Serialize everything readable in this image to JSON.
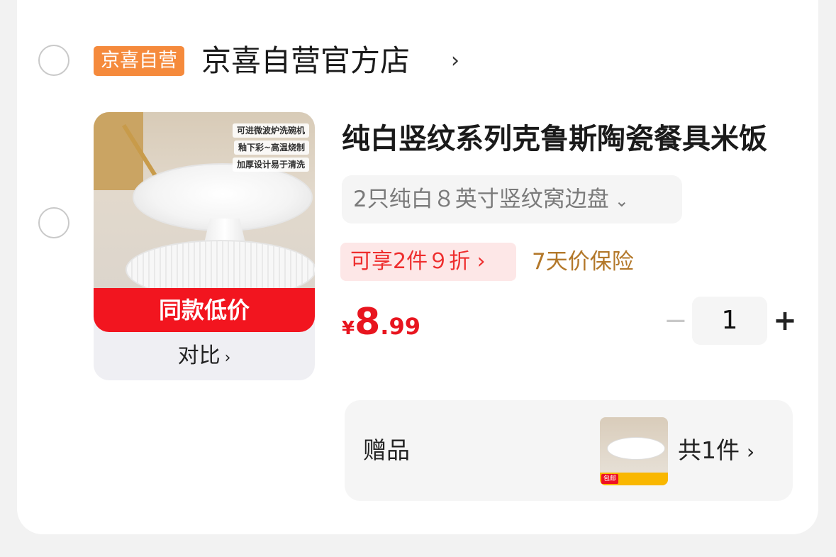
{
  "store": {
    "badge": "京喜自营",
    "name": "京喜自营官方店",
    "chevron": "›"
  },
  "product": {
    "image_captions": [
      "可进微波炉洗碗机",
      "釉下彩~高温烧制",
      "加厚设计易于清洗"
    ],
    "low_price_banner": "同款低价",
    "compare_label": "对比",
    "compare_chevron": "›",
    "title": "纯白竖纹系列克鲁斯陶瓷餐具米饭",
    "spec": "2只纯白８英寸竖纹窝边盘",
    "spec_chevron": "⌄",
    "promo": "可享2件９折 ›",
    "insurance": "7天价保险",
    "price": {
      "symbol": "¥",
      "integer": "8",
      "decimal": ".99"
    },
    "quantity": {
      "minus": "−",
      "value": "1",
      "plus": "+"
    }
  },
  "gift": {
    "label": "赠品",
    "count": "共1件",
    "chevron": "›",
    "mini_tag": "包邮"
  },
  "colors": {
    "price_red": "#e8151f",
    "badge_orange": "#f58a3c",
    "insurance_gold": "#b3782a"
  }
}
